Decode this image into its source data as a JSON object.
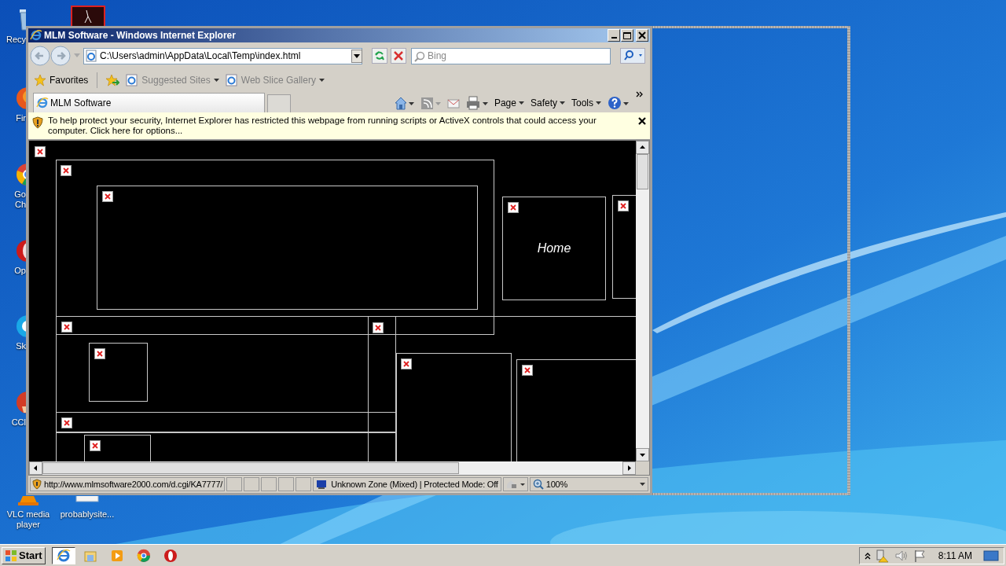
{
  "desktop_icons": [
    {
      "label": "Recy",
      "kind": "bin"
    },
    {
      "label": "Fir",
      "kind": "firefox"
    },
    {
      "label": "Go\nCh",
      "kind": "chrome"
    },
    {
      "label": "Op",
      "kind": "opera"
    },
    {
      "label": "Sk",
      "kind": "skype"
    },
    {
      "label": "CCl",
      "kind": "ccleaner"
    },
    {
      "label": "VLC media\nplayer",
      "kind": "vlc"
    },
    {
      "label": "probablysite...",
      "kind": "file"
    }
  ],
  "window": {
    "title": "MLM Software - Windows Internet Explorer",
    "address": "C:\\Users\\admin\\AppData\\Local\\Temp\\index.html",
    "search": {
      "placeholder": "Bing"
    },
    "favorites_bar": {
      "favorites": "Favorites",
      "links": [
        "Suggested Sites",
        "Web Slice Gallery"
      ]
    },
    "tabs": [
      {
        "label": "MLM Software",
        "selected": true
      }
    ],
    "command_bar": [
      "Page",
      "Safety",
      "Tools"
    ],
    "info_bar": "To help protect your security, Internet Explorer has restricted this webpage from running scripts or ActiveX controls that could access your computer. Click here for options...",
    "page": {
      "home_label": "Home"
    },
    "status_bar": {
      "url": "http://www.mlmsoftware2000.com/d.cgi/KA7777/",
      "zone": "Unknown Zone (Mixed) | Protected Mode: Off",
      "zoom": "100%"
    }
  },
  "taskbar": {
    "start": "Start",
    "apps": [
      {
        "kind": "ie",
        "selected": true
      },
      {
        "kind": "explorer",
        "selected": false
      },
      {
        "kind": "media",
        "selected": false
      },
      {
        "kind": "chrome",
        "selected": false
      },
      {
        "kind": "opera",
        "selected": false
      }
    ],
    "clock": "8:11 AM"
  }
}
